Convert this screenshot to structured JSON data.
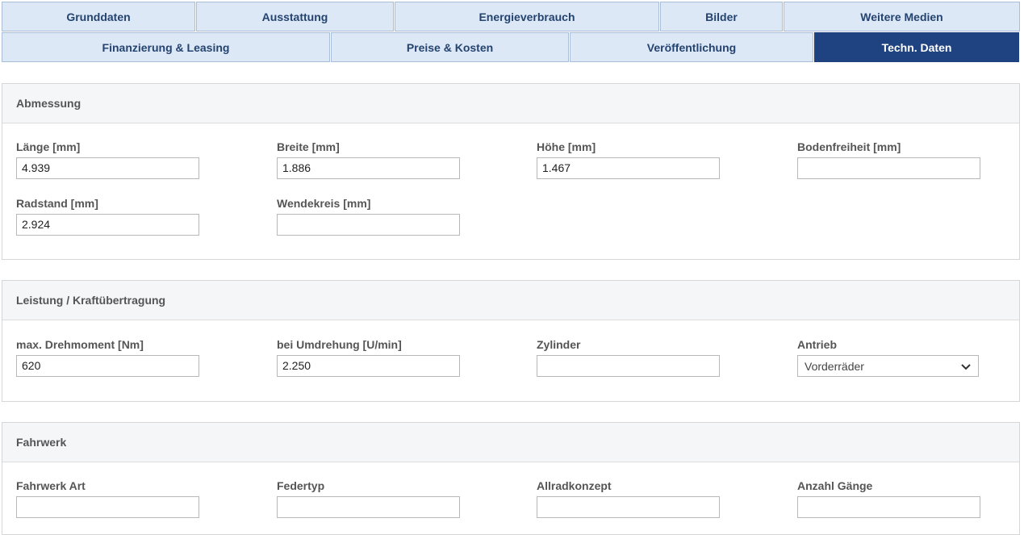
{
  "tabs": {
    "row1": [
      "Grunddaten",
      "Ausstattung",
      "Energieverbrauch",
      "Bilder",
      "Weitere Medien"
    ],
    "row2": [
      "Finanzierung & Leasing",
      "Preise & Kosten",
      "Veröffentlichung",
      "Techn. Daten"
    ],
    "active": "Techn. Daten"
  },
  "sections": {
    "abmessung": {
      "title": "Abmessung",
      "fields": {
        "laenge": {
          "label": "Länge [mm]",
          "value": "4.939"
        },
        "breite": {
          "label": "Breite [mm]",
          "value": "1.886"
        },
        "hoehe": {
          "label": "Höhe [mm]",
          "value": "1.467"
        },
        "bodenfreiheit": {
          "label": "Bodenfreiheit [mm]",
          "value": ""
        },
        "radstand": {
          "label": "Radstand [mm]",
          "value": "2.924"
        },
        "wendekreis": {
          "label": "Wendekreis [mm]",
          "value": ""
        }
      }
    },
    "leistung": {
      "title": "Leistung / Kraftübertragung",
      "fields": {
        "drehmoment": {
          "label": "max. Drehmoment [Nm]",
          "value": "620"
        },
        "umdrehung": {
          "label": "bei Umdrehung [U/min]",
          "value": "2.250"
        },
        "zylinder": {
          "label": "Zylinder",
          "value": ""
        },
        "antrieb": {
          "label": "Antrieb",
          "value": "Vorderräder"
        }
      }
    },
    "fahrwerk": {
      "title": "Fahrwerk",
      "fields": {
        "fahrwerk_art": {
          "label": "Fahrwerk Art",
          "value": ""
        },
        "federtyp": {
          "label": "Federtyp",
          "value": ""
        },
        "allradkonzept": {
          "label": "Allradkonzept",
          "value": ""
        },
        "anzahl_gaenge": {
          "label": "Anzahl Gänge",
          "value": ""
        }
      }
    }
  },
  "icons": {
    "select_arrow": "chevron-down-icon"
  },
  "colors": {
    "tab_bg": "#dde8f7",
    "tab_text": "#24446f",
    "tab_active_bg": "#1f4280",
    "tab_active_text": "#ffffff"
  }
}
